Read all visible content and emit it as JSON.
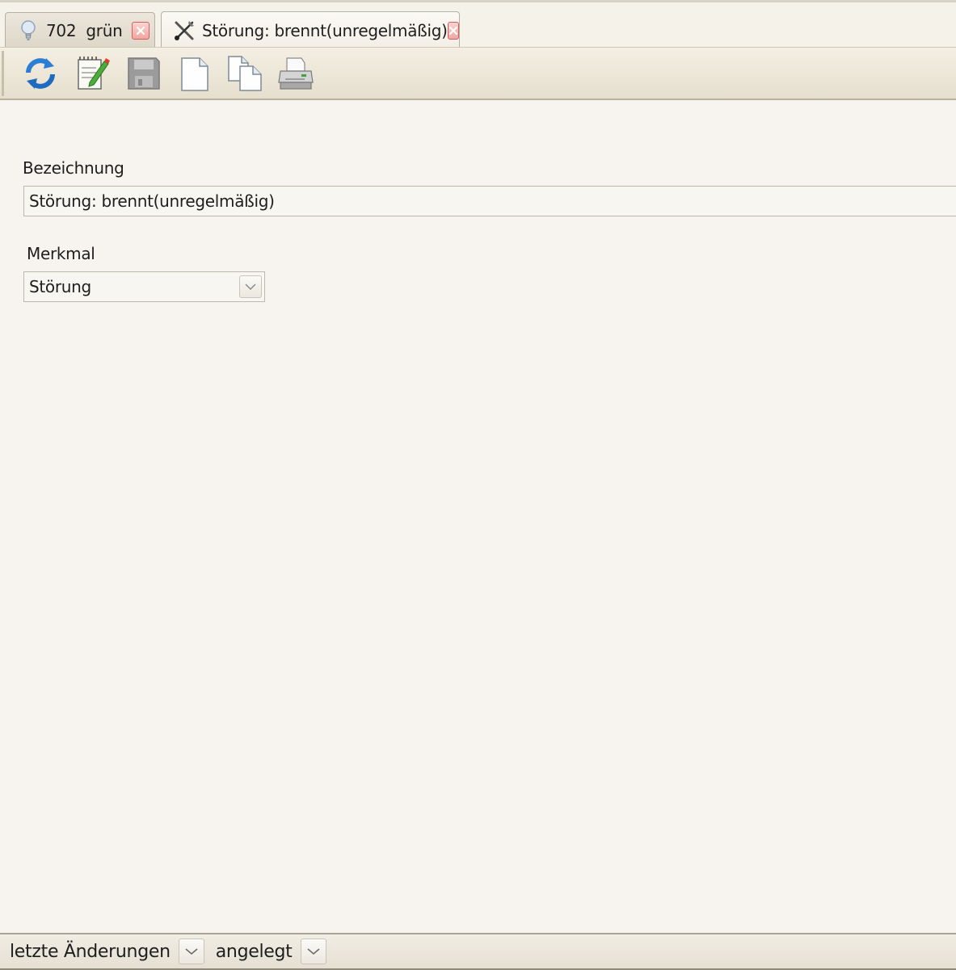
{
  "tabs": [
    {
      "label": "702  grün",
      "icon": "lightbulb-icon",
      "active": false
    },
    {
      "label": "Störung: brennt(unregelmäßig)",
      "icon": "tools-icon",
      "active": true
    }
  ],
  "toolbar": {
    "buttons": [
      "refresh-icon",
      "edit-icon",
      "save-icon",
      "new-document-icon",
      "copy-document-icon",
      "print-icon"
    ]
  },
  "form": {
    "bezeichnung_label": "Bezeichnung",
    "bezeichnung_value": "Störung: brennt(unregelmäßig)",
    "merkmal_label": "Merkmal",
    "merkmal_value": "Störung"
  },
  "bottom": {
    "changes_label": "letzte Änderungen",
    "created_label": "angelegt"
  },
  "colors": {
    "background": "#f7f4ef",
    "close_red": "#d9534f",
    "refresh_blue": "#2a7fd4"
  }
}
